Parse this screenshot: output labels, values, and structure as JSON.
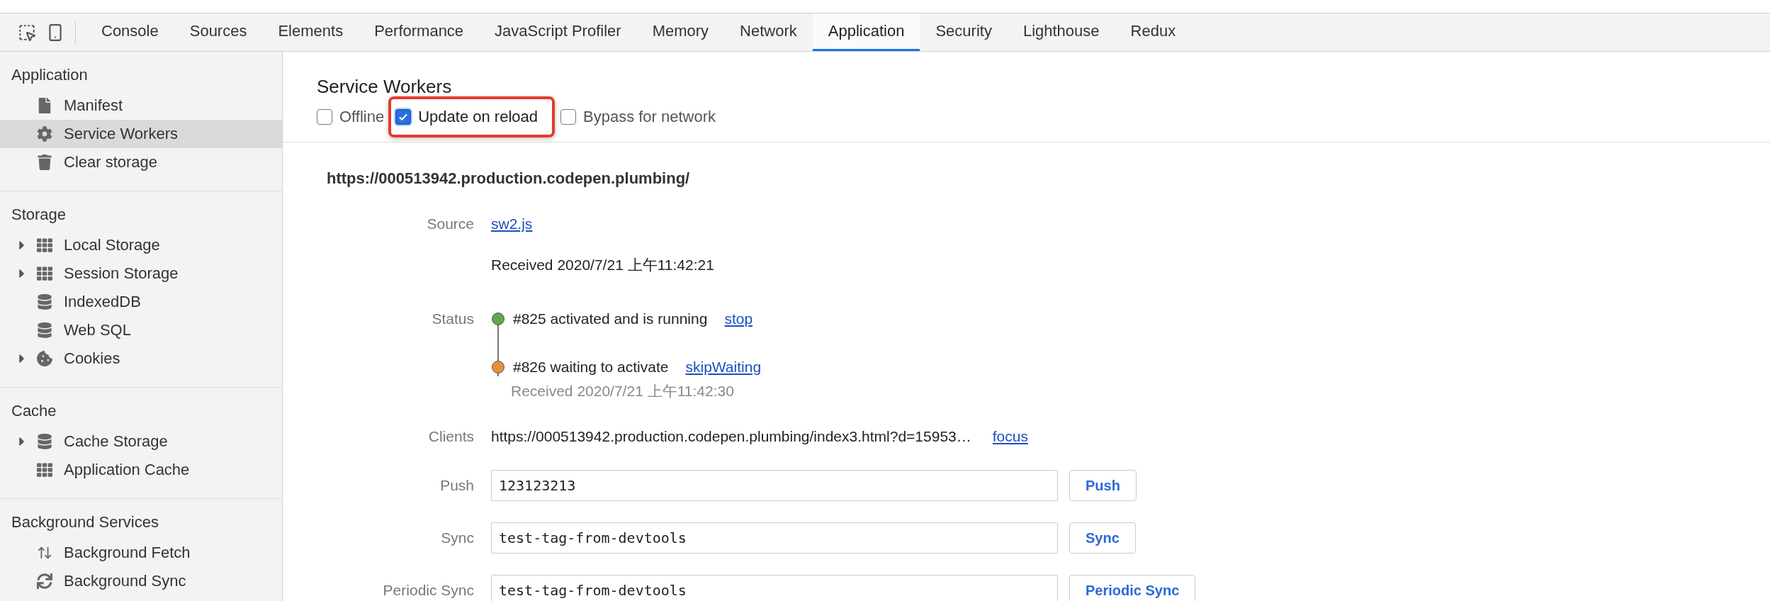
{
  "tabs": [
    {
      "label": "Console",
      "selected": false
    },
    {
      "label": "Sources",
      "selected": false
    },
    {
      "label": "Elements",
      "selected": false
    },
    {
      "label": "Performance",
      "selected": false
    },
    {
      "label": "JavaScript Profiler",
      "selected": false
    },
    {
      "label": "Memory",
      "selected": false
    },
    {
      "label": "Network",
      "selected": false
    },
    {
      "label": "Application",
      "selected": true
    },
    {
      "label": "Security",
      "selected": false
    },
    {
      "label": "Lighthouse",
      "selected": false
    },
    {
      "label": "Redux",
      "selected": false
    }
  ],
  "sidebar": {
    "sections": [
      {
        "title": "Application",
        "items": [
          {
            "label": "Manifest",
            "kind": "document",
            "expandable": false,
            "selected": false
          },
          {
            "label": "Service Workers",
            "kind": "settings",
            "expandable": false,
            "selected": true
          },
          {
            "label": "Clear storage",
            "kind": "trash",
            "expandable": false,
            "selected": false
          }
        ]
      },
      {
        "title": "Storage",
        "items": [
          {
            "label": "Local Storage",
            "kind": "table",
            "expandable": true,
            "selected": false
          },
          {
            "label": "Session Storage",
            "kind": "table",
            "expandable": true,
            "selected": false
          },
          {
            "label": "IndexedDB",
            "kind": "database",
            "expandable": false,
            "selected": false
          },
          {
            "label": "Web SQL",
            "kind": "database",
            "expandable": false,
            "selected": false
          },
          {
            "label": "Cookies",
            "kind": "cookie",
            "expandable": true,
            "selected": false
          }
        ]
      },
      {
        "title": "Cache",
        "items": [
          {
            "label": "Cache Storage",
            "kind": "database",
            "expandable": true,
            "selected": false
          },
          {
            "label": "Application Cache",
            "kind": "table",
            "expandable": false,
            "selected": false
          }
        ]
      },
      {
        "title": "Background Services",
        "items": [
          {
            "label": "Background Fetch",
            "kind": "transfer",
            "expandable": false,
            "selected": false
          },
          {
            "label": "Background Sync",
            "kind": "sync",
            "expandable": false,
            "selected": false
          }
        ]
      }
    ]
  },
  "panel": {
    "title": "Service Workers",
    "options": [
      {
        "label": "Offline",
        "checked": false,
        "highlighted": false
      },
      {
        "label": "Update on reload",
        "checked": true,
        "highlighted": true
      },
      {
        "label": "Bypass for network",
        "checked": false,
        "highlighted": false
      }
    ],
    "worker": {
      "scope": "https://000513942.production.codepen.plumbing/",
      "source": {
        "label": "Source",
        "link": "sw2.js",
        "received": "Received 2020/7/21 上午11:42:21"
      },
      "status": {
        "label": "Status",
        "entries": [
          {
            "text": "#825 activated and is running",
            "action": "stop",
            "color": "#5ea84e"
          },
          {
            "text": "#826 waiting to activate",
            "action": "skipWaiting",
            "color": "#e8913a",
            "received": "Received 2020/7/21 上午11:42:30"
          }
        ]
      },
      "clients": {
        "label": "Clients",
        "url": "https://000513942.production.codepen.plumbing/index3.html?d=15953…",
        "action": "focus"
      },
      "fields": [
        {
          "label": "Push",
          "value": "123123213",
          "button": "Push"
        },
        {
          "label": "Sync",
          "value": "test-tag-from-devtools",
          "button": "Sync"
        },
        {
          "label": "Periodic Sync",
          "value": "test-tag-from-devtools",
          "button": "Periodic Sync"
        }
      ]
    }
  }
}
